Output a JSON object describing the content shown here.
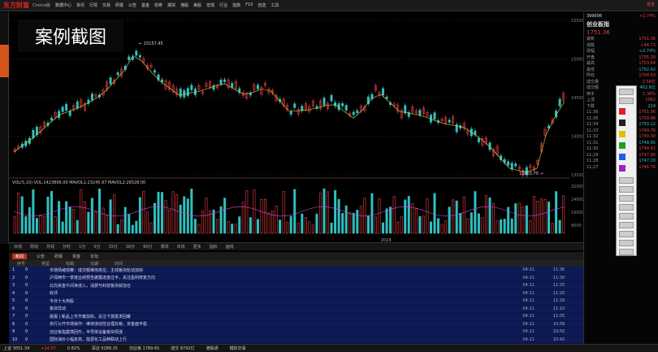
{
  "app": {
    "logo": "东方财富",
    "logo_sub": "Choice版",
    "menu": [
      "数据中心",
      "资讯",
      "行情",
      "交易",
      "研报",
      "公告",
      "基金",
      "债券",
      "期货",
      "港股",
      "美股",
      "宏观",
      "行业",
      "指数",
      "F10",
      "自选",
      "工具"
    ],
    "top_right": "登录"
  },
  "overlay_label": "案例截图",
  "chart": {
    "price_high_label": "15157.45",
    "price_low_label": "13403.70",
    "indicator_label": "VOL(5,10)  VOL:1423806.00  MAVOL1:23245.97  MAVOL2:26528.00",
    "year_label": "2024",
    "y_ticks": [
      "15500",
      "15000",
      "14500",
      "14000",
      "13500"
    ],
    "vol_ticks": [
      "32000",
      "24000",
      "16000",
      "8000"
    ]
  },
  "tabs": [
    "日线",
    "周线",
    "月线",
    "分时",
    "1分",
    "5分",
    "15分",
    "30分",
    "60分",
    "季线",
    "年线",
    "更多",
    "指标",
    "画线"
  ],
  "news_tabs": [
    "新闻",
    "公告",
    "研报",
    "资金",
    "论坛"
  ],
  "news_header": [
    "序号",
    "类型",
    "标题",
    "日期",
    "时间"
  ],
  "news": [
    {
      "n": "1",
      "t": "0",
      "title": "市场情绪观察：成交额维持高位，主线板块轮动加快",
      "date": "04-11",
      "time": "11:36"
    },
    {
      "n": "2",
      "t": "0",
      "title": "沪深两市一季度业绩预告披露进度过半，关注盈利修复方向",
      "date": "04-11",
      "time": "11:30"
    },
    {
      "n": "3",
      "t": "0",
      "title": "北向资金午间净流入，消费与科技板块获加仓",
      "date": "04-11",
      "time": "11:25"
    },
    {
      "n": "4",
      "t": "0",
      "title": "收评",
      "date": "04-11",
      "time": "11:20"
    },
    {
      "n": "5",
      "t": "0",
      "title": "今日十大热股",
      "date": "04-11",
      "time": "11:18"
    },
    {
      "n": "6",
      "t": "0",
      "title": "板块异动",
      "date": "04-11",
      "time": "11:10"
    },
    {
      "n": "7",
      "t": "0",
      "title": "晨报 | 新品上市节奏加快，关注下游需求回暖",
      "date": "04-11",
      "time": "11:05"
    },
    {
      "n": "8",
      "t": "0",
      "title": "央行公开市场操作：维持流动性合理充裕，资金面平稳",
      "date": "04-11",
      "time": "10:58"
    },
    {
      "n": "9",
      "t": "0",
      "title": "创业板指震荡回升，半导体设备板块领涨",
      "date": "04-11",
      "time": "10:50"
    },
    {
      "n": "10",
      "t": "0",
      "title": "国际油价小幅走高，能源化工品种联动上行",
      "date": "04-11",
      "time": "10:42"
    }
  ],
  "status": {
    "items": [
      "上证 3051.34",
      "+24.97",
      "0.82%",
      "深证 9288.25",
      "创业板 1789.65",
      "成交 8792亿",
      "港股通",
      "模拟交易"
    ]
  },
  "right_panel": {
    "code": "399006",
    "name": "创业板指",
    "price": "1751.36",
    "change": "+2.74%",
    "rows": [
      {
        "label": "最新",
        "value": "1751.36"
      },
      {
        "label": "涨跌",
        "value": "+46.73"
      },
      {
        "label": "涨幅",
        "value": "+2.74%"
      },
      {
        "label": "开盘",
        "value": "1705.20"
      },
      {
        "label": "最高",
        "value": "1753.64"
      },
      {
        "label": "最低",
        "value": "1702.42"
      },
      {
        "label": "昨收",
        "value": "1704.63"
      },
      {
        "label": "成交量",
        "value": "2.58亿"
      },
      {
        "label": "成交额",
        "value": "462.8亿"
      },
      {
        "label": "换手",
        "value": "1.38%"
      },
      {
        "label": "上涨",
        "value": "1062"
      },
      {
        "label": "下跌",
        "value": "224"
      },
      {
        "label": "11:36",
        "value": "1751.36"
      },
      {
        "label": "11:35",
        "value": "1750.88"
      },
      {
        "label": "11:34",
        "value": "1750.12"
      },
      {
        "label": "11:33",
        "value": "1749.76"
      },
      {
        "label": "11:32",
        "value": "1749.30"
      },
      {
        "label": "11:31",
        "value": "1748.95"
      },
      {
        "label": "11:30",
        "value": "1748.41"
      },
      {
        "label": "11:29",
        "value": "1747.86"
      },
      {
        "label": "11:28",
        "value": "1747.20"
      },
      {
        "label": "11:27",
        "value": "1746.74"
      }
    ]
  },
  "colors": {
    "up": "#e84040",
    "down": "#30c0c0",
    "news_bg": "#0d1a55"
  }
}
